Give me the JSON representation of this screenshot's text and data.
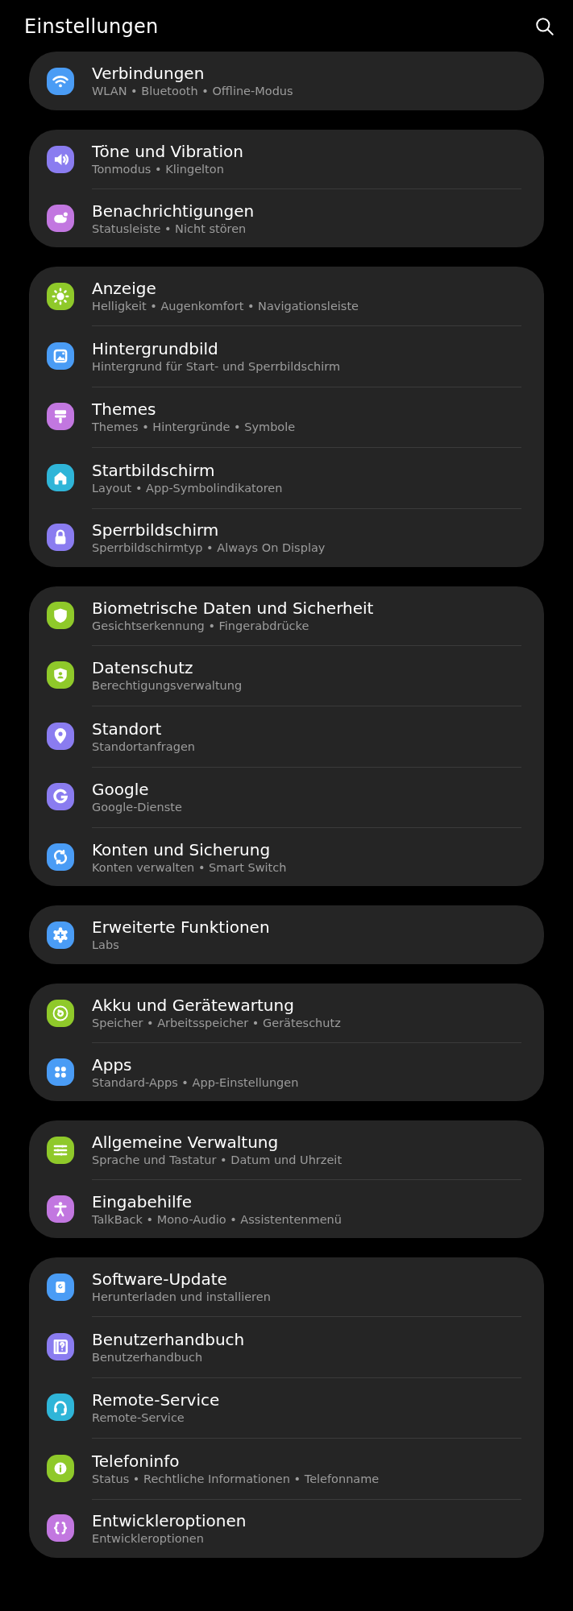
{
  "header": {
    "title": "Einstellungen"
  },
  "groups": [
    {
      "items": [
        {
          "title": "Verbindungen",
          "subtitle": "WLAN • Bluetooth • Offline-Modus",
          "color": "#4a9cf5"
        }
      ]
    },
    {
      "items": [
        {
          "title": "Töne und Vibration",
          "subtitle": "Tonmodus • Klingelton",
          "color": "#8a7cf0"
        },
        {
          "title": "Benachrichtigungen",
          "subtitle": "Statusleiste • Nicht stören",
          "color": "#c277e0"
        }
      ]
    },
    {
      "items": [
        {
          "title": "Anzeige",
          "subtitle": "Helligkeit • Augenkomfort • Navigationsleiste",
          "color": "#8fc92a"
        },
        {
          "title": "Hintergrundbild",
          "subtitle": "Hintergrund für Start- und Sperrbildschirm",
          "color": "#4a9cf5"
        },
        {
          "title": "Themes",
          "subtitle": "Themes • Hintergründe • Symbole",
          "color": "#c277e0"
        },
        {
          "title": "Startbildschirm",
          "subtitle": "Layout • App-Symbolindikatoren",
          "color": "#2fb5d8"
        },
        {
          "title": "Sperrbildschirm",
          "subtitle": "Sperrbildschirmtyp • Always On Display",
          "color": "#8a7cf0"
        }
      ]
    },
    {
      "items": [
        {
          "title": "Biometrische Daten und Sicherheit",
          "subtitle": "Gesichtserkennung • Fingerabdrücke",
          "color": "#8fc92a"
        },
        {
          "title": "Datenschutz",
          "subtitle": "Berechtigungsverwaltung",
          "color": "#8fc92a"
        },
        {
          "title": "Standort",
          "subtitle": "Standortanfragen",
          "color": "#8a7cf0"
        },
        {
          "title": "Google",
          "subtitle": "Google-Dienste",
          "color": "#8a7cf0"
        },
        {
          "title": "Konten und Sicherung",
          "subtitle": "Konten verwalten • Smart Switch",
          "color": "#4a9cf5"
        }
      ]
    },
    {
      "items": [
        {
          "title": "Erweiterte Funktionen",
          "subtitle": "Labs",
          "color": "#4a9cf5"
        }
      ]
    },
    {
      "items": [
        {
          "title": "Akku und Gerätewartung",
          "subtitle": "Speicher • Arbeitsspeicher • Geräteschutz",
          "color": "#8fc92a"
        },
        {
          "title": "Apps",
          "subtitle": "Standard-Apps • App-Einstellungen",
          "color": "#4a9cf5"
        }
      ]
    },
    {
      "items": [
        {
          "title": "Allgemeine Verwaltung",
          "subtitle": "Sprache und Tastatur • Datum und Uhrzeit",
          "color": "#8fc92a"
        },
        {
          "title": "Eingabehilfe",
          "subtitle": "TalkBack • Mono-Audio • Assistentenmenü",
          "color": "#c277e0"
        }
      ]
    },
    {
      "items": [
        {
          "title": "Software-Update",
          "subtitle": "Herunterladen und installieren",
          "color": "#4a9cf5"
        },
        {
          "title": "Benutzerhandbuch",
          "subtitle": "Benutzerhandbuch",
          "color": "#8a7cf0"
        },
        {
          "title": "Remote-Service",
          "subtitle": "Remote-Service",
          "color": "#2fb5d8"
        },
        {
          "title": "Telefoninfo",
          "subtitle": "Status • Rechtliche Informationen • Telefonname",
          "color": "#8fc92a"
        },
        {
          "title": "Entwickleroptionen",
          "subtitle": "Entwickleroptionen",
          "color": "#c277e0"
        }
      ]
    }
  ]
}
